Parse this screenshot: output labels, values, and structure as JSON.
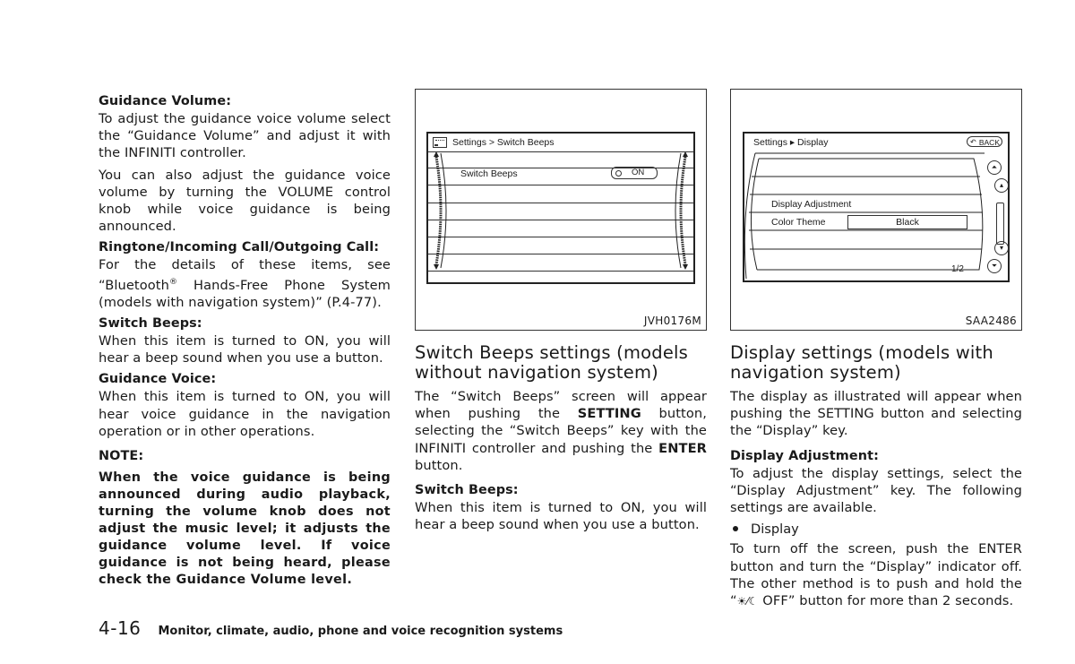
{
  "column1": {
    "guidance_volume": {
      "heading": "Guidance Volume:",
      "paragraphs": [
        "To adjust the guidance voice volume select the “Guidance Volume” and adjust it with the INFINITI controller.",
        "You can also adjust the guidance voice volume by turning the VOLUME control knob while voice guidance is being announced."
      ]
    },
    "ringtone": {
      "heading": "Ringtone/Incoming Call/Outgoing Call:",
      "text_before": "For the details of these items, see “Bluetooth",
      "registered": "®",
      "text_after": " Hands-Free Phone System (models with navigation system)” (P.4-77)."
    },
    "switch_beeps": {
      "heading": "Switch Beeps:",
      "text": "When this item is turned to ON, you will hear a beep sound when you use a button."
    },
    "guidance_voice": {
      "heading": "Guidance Voice:",
      "text": "When this item is turned to ON, you will hear voice guidance in the navigation operation or in other operations."
    },
    "note": {
      "title": "NOTE:",
      "text": "When the voice guidance is being announced during audio playback, turning the volume knob does not adjust the music level; it adjusts the guidance volume level. If voice guidance is not being heard, please check the Guidance Volume level."
    }
  },
  "figure1": {
    "code": "JVH0176M",
    "screen_title": "Settings > Switch Beeps",
    "item_label": "Switch Beeps",
    "toggle_value": "ON"
  },
  "figure2": {
    "code": "SAA2486",
    "screen_title": "Settings ▸ Display",
    "back_label": "BACK",
    "rows": [
      "Display Adjustment",
      "Color Theme"
    ],
    "color_theme_value": "Black",
    "page_indicator": "1/2"
  },
  "column2": {
    "title": "Switch Beeps settings (models without navigation system)",
    "intro": {
      "t1": "The “Switch Beeps” screen will appear when pushing the ",
      "b1": "SETTING",
      "t2": " button, selecting the “Switch Beeps” key with the INFINITI controller and pushing the ",
      "b2": "ENTER",
      "t3": " button."
    },
    "switch_beeps": {
      "heading": "Switch Beeps:",
      "text": "When this item is turned to ON, you will hear a beep sound when you use a button."
    }
  },
  "column3": {
    "title": "Display settings (models with navigation system)",
    "intro": "The display as illustrated will appear when pushing the SETTING button and selecting the “Display” key.",
    "display_adjustment": {
      "heading": "Display Adjustment:",
      "text": "To adjust the display settings, select the “Display Adjustment” key. The following settings are available."
    },
    "bullet": "Display",
    "display_text_1": "To turn off the screen, push the ENTER button and turn the “Display” indicator off. The other method is to push and hold the “",
    "display_icon": "day-night-icon",
    "display_text_2": " OFF” button for more than 2 seconds."
  },
  "footer": {
    "page_number": "4-16",
    "chapter": "Monitor, climate, audio, phone and voice recognition systems"
  }
}
